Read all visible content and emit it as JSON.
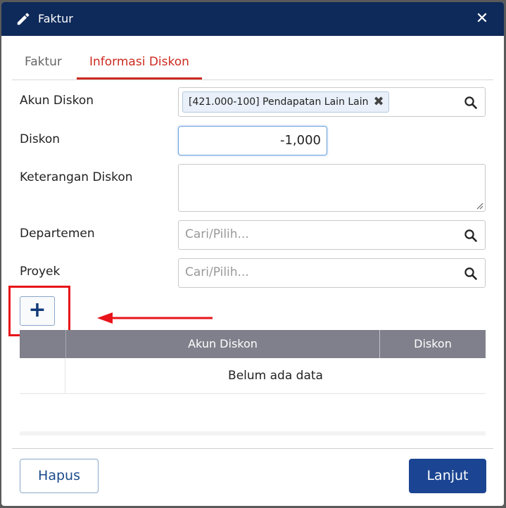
{
  "dialog": {
    "title": "Faktur",
    "title_icon": "pencil-icon",
    "close_icon": "close-icon",
    "close_glyph": "✕"
  },
  "tabs": [
    {
      "label": "Faktur",
      "active": false
    },
    {
      "label": "Informasi Diskon",
      "active": true
    }
  ],
  "form": {
    "akun_diskon": {
      "label": "Akun Diskon",
      "selected_value": "[421.000-100] Pendapatan Lain Lain",
      "remove_glyph": "✖"
    },
    "diskon": {
      "label": "Diskon",
      "value": "-1,000"
    },
    "keterangan_diskon": {
      "label": "Keterangan Diskon",
      "value": ""
    },
    "departemen": {
      "label": "Departemen",
      "placeholder": "Cari/Pilih..."
    },
    "proyek": {
      "label": "Proyek",
      "placeholder": "Cari/Pilih..."
    }
  },
  "add_button": {
    "glyph": "+"
  },
  "table": {
    "columns": [
      "Akun Diskon",
      "Diskon"
    ],
    "empty_text": "Belum ada data"
  },
  "footer": {
    "delete_label": "Hapus",
    "next_label": "Lanjut"
  },
  "colors": {
    "titlebar": "#0e2a5a",
    "active_tab": "#cc2a1f",
    "primary_button": "#1b4592",
    "annotation": "#e8141a"
  }
}
